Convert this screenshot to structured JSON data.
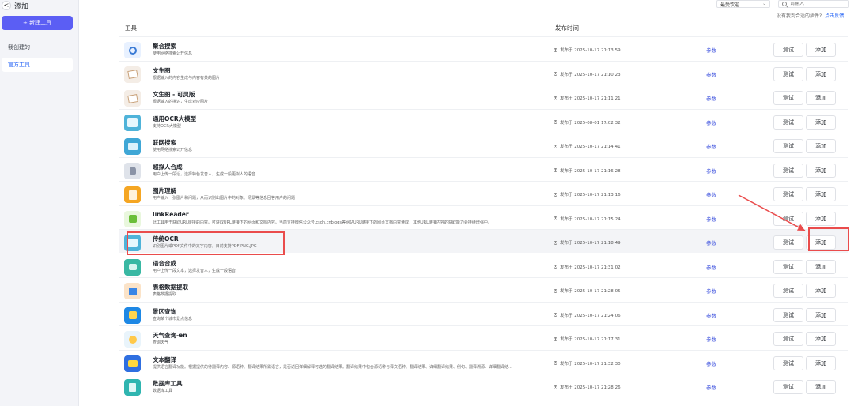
{
  "sidebar": {
    "back_label": "<",
    "title": "添加",
    "new_tool_label": "+ 新建工具",
    "items": [
      {
        "label": "我创建的"
      },
      {
        "label": "官方工具"
      }
    ]
  },
  "toolbar": {
    "sort_value": "最受欢迎",
    "search_placeholder": "请输入",
    "hint_text": "没有我到合适的插件?",
    "hint_link": "点击反馈"
  },
  "table": {
    "col_tool": "工具",
    "col_publish": "发布时间",
    "params_label": "参数",
    "test_label": "测试",
    "add_label": "添加",
    "rows": [
      {
        "name": "聚合搜索",
        "desc": "使用网络搜索公开信息",
        "time": "发布于 2025-10-17 21:13:59",
        "icon": "search-icon"
      },
      {
        "name": "文生图",
        "desc": "根据输入的内容生成与内容有关的图片",
        "time": "发布于 2025-10-17 21:10:23",
        "icon": "image-gen-icon"
      },
      {
        "name": "文生图 - 可灵版",
        "desc": "根据输入的描述，生成对应图片",
        "time": "发布于 2025-10-17 21:11:21",
        "icon": "image-gen-icon"
      },
      {
        "name": "通用OCR大模型",
        "desc": "支持OCR大模型",
        "time": "发布于 2025-08-01 17:02:32",
        "icon": "ocr-icon"
      },
      {
        "name": "联网搜索",
        "desc": "使用网络搜索公开信息",
        "time": "发布于 2025-10-17 21:14:41",
        "icon": "web-search-icon"
      },
      {
        "name": "超拟人合成",
        "desc": "用户上传一段话，选择特色发音人，生成一段更拟人的语音",
        "time": "发布于 2025-10-17 21:16:28",
        "icon": "voice-avatar-icon"
      },
      {
        "name": "图片理解",
        "desc": "用户输入一张图片和问题，从而识别出图片中的对象、场景等信息回答用户的问题",
        "time": "发布于 2025-10-17 21:13:16",
        "icon": "image-understand-icon"
      },
      {
        "name": "linkReader",
        "desc": "此工具用于获取URL链接的内容。可获取URL链接下的网页和文档内容。当前支持微信公众号,csdn,cnblogs等网站URL链接下的网页文档内容读取，其他URL链接内容的获取能力会持续增强中。",
        "time": "发布于 2025-10-17 21:15:24",
        "icon": "link-reader-icon"
      },
      {
        "name": "传统OCR",
        "desc": "识别图片或PDF文件中的文字内容，目前支持PDF,PNG,JPG",
        "time": "发布于 2025-10-17 21:18:49",
        "icon": "ocr-icon"
      },
      {
        "name": "语音合成",
        "desc": "用户上传一段文本，选择发音人，生成一段语音",
        "time": "发布于 2025-10-17 21:31:02",
        "icon": "tts-icon"
      },
      {
        "name": "表格数据提取",
        "desc": "表格数据提取",
        "time": "发布于 2025-10-17 21:28:05",
        "icon": "table-extract-icon"
      },
      {
        "name": "景区查询",
        "desc": "查询某个城市景点信息",
        "time": "发布于 2025-10-17 21:24:06",
        "icon": "scenic-icon"
      },
      {
        "name": "天气查询-en",
        "desc": "查询天气",
        "time": "发布于 2025-10-17 21:17:31",
        "icon": "weather-icon"
      },
      {
        "name": "文本翻译",
        "desc": "提供语言翻译功能。根据提供的待翻译内容、源语种、翻译结果所需语言，是否返回详细解释可选的翻译结果。翻译结果中包含源语种与译文语种、翻译结果、详细翻译结果、例句、翻译溯源、详细翻译结...",
        "time": "发布于 2025-10-17 21:32:30",
        "icon": "translate-icon"
      },
      {
        "name": "数据库工具",
        "desc": "数据库工具",
        "time": "发布于 2025-10-17 21:28:26",
        "icon": "database-icon"
      }
    ]
  },
  "colors": {
    "accent": "#5b5ef4",
    "link": "#1f5ff5",
    "annotation": "#ea4c4c"
  }
}
